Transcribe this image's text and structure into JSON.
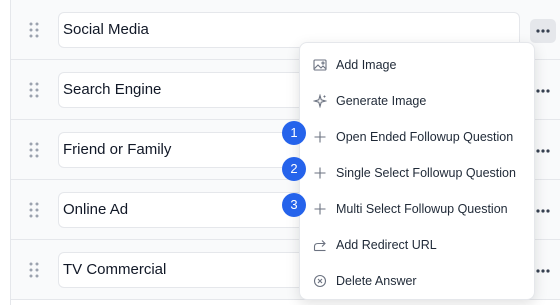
{
  "answers": [
    {
      "label": "Social Media"
    },
    {
      "label": "Search Engine"
    },
    {
      "label": "Friend or Family"
    },
    {
      "label": "Online Ad"
    },
    {
      "label": "TV Commercial"
    }
  ],
  "menu": {
    "items": [
      {
        "label": "Add Image",
        "icon": "image-icon"
      },
      {
        "label": "Generate Image",
        "icon": "sparkle-icon"
      },
      {
        "label": "Open Ended Followup Question",
        "icon": "plus-icon"
      },
      {
        "label": "Single Select Followup Question",
        "icon": "plus-icon"
      },
      {
        "label": "Multi Select Followup Question",
        "icon": "plus-icon"
      },
      {
        "label": "Add Redirect URL",
        "icon": "redirect-icon"
      },
      {
        "label": "Delete Answer",
        "icon": "delete-circle-icon"
      }
    ]
  },
  "badges": [
    "1",
    "2",
    "3"
  ],
  "colors": {
    "badge": "#2563eb",
    "row_bg": "#f9fafb",
    "border": "#e5e7eb"
  }
}
